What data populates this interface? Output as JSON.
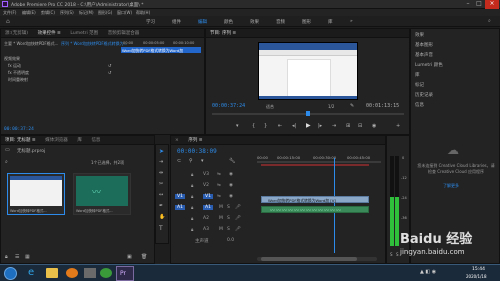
{
  "titlebar": {
    "title": "Adobe Premiere Pro CC 2018 - C:\\用户\\Administrator\\桌面\\ *",
    "menu": [
      "文件(F)",
      "编辑(E)",
      "剪辑(C)",
      "序列(S)",
      "标记(M)",
      "图形(G)",
      "窗口(W)",
      "帮助(H)"
    ]
  },
  "workspaces": [
    "学习",
    "组件",
    "编辑",
    "颜色",
    "效果",
    "音频",
    "图形",
    "库",
    "»"
  ],
  "source_panel": {
    "tabs": [
      "源:(无剪辑)",
      "效果控件 ≡",
      "Lumetri 范围",
      "音频剪辑混合器"
    ],
    "seq_labels": [
      "主要 * Word加快转PDF格式...",
      "序列 * Word加快转PDF格式转换为..."
    ],
    "ruler_times": [
      "00:00",
      "00:00:05:00",
      "00:00:10:00"
    ],
    "clip_label": "Word加快转PDF格式转换为Word加",
    "sections": [
      "视频效果",
      "fx 运动",
      "fx 不透明度",
      "时间重映射"
    ],
    "timecode": "00:00:37:24"
  },
  "program_panel": {
    "tab": "节目: 序列 ≡",
    "timecode_left": "00:00:37:24",
    "fit": "适合",
    "ratio": "1/2",
    "timecode_right": "00:01:13:15"
  },
  "project_panel": {
    "tabs": [
      "项目: 无标题 ≡",
      "媒体浏览器",
      "库",
      "信息"
    ],
    "project_file": "无标题.prproj",
    "item_count": "1个已选择，共2项",
    "items": [
      {
        "name": "Word加快转PDF格式...",
        "duration": "1:13:15"
      },
      {
        "name": "Word加快转PDF格式...",
        "duration": "1:13:15"
      }
    ]
  },
  "timeline_panel": {
    "tab": "序列 ≡",
    "timecode": "00:00:38:09",
    "ruler_times": [
      "00:00",
      "00:00:15:00",
      "00:00:30:00",
      "00:00:45:00"
    ],
    "video_tracks": [
      "V3",
      "V2",
      "V1"
    ],
    "audio_tracks": [
      "A1",
      "A2",
      "A3"
    ],
    "master": "主声道",
    "master_value": "0.0",
    "clip_label": "Word加快转PDF格式转换为Word加 [V]"
  },
  "right_panel": {
    "items": [
      "效果",
      "基本图形",
      "基本声音",
      "Lumetri 颜色",
      "库",
      "标记",
      "历史记录",
      "信息"
    ],
    "cc_message": "您未连接到 Creative Cloud Libraries，请检查 Creative Cloud 应用程序",
    "cc_link": "了解更多"
  },
  "audio_meter": {
    "scale": [
      "0",
      "-12",
      "-24",
      "-36",
      "-48"
    ],
    "level": 0.55
  },
  "taskbar": {
    "time": "15:44",
    "date": "2020/1/18",
    "pr_label": "Pr"
  },
  "watermark": {
    "brand": "Baidu 经验",
    "url": "jingyan.baidu.com"
  },
  "colors": {
    "accent": "#2d8ceb",
    "clip_video": "#8aa7c8",
    "clip_audio": "#3a8a5a",
    "playhead": "#e04040"
  }
}
